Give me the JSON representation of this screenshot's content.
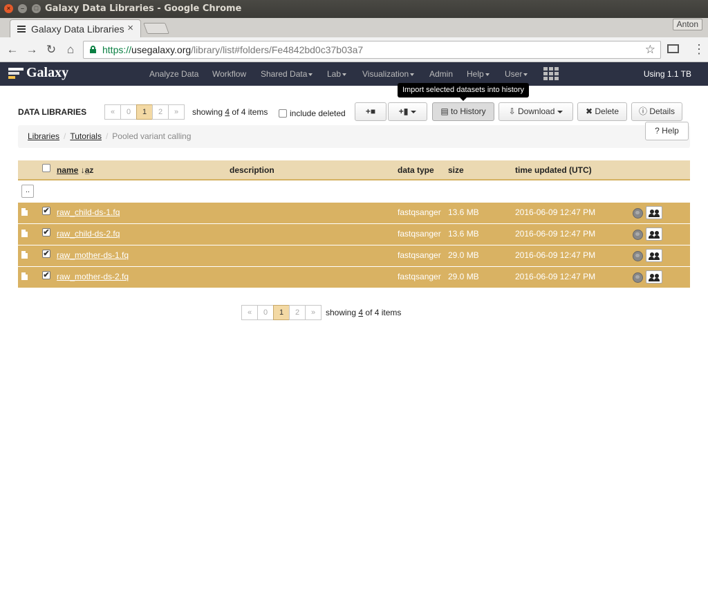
{
  "window": {
    "title": "Galaxy Data Libraries - Google Chrome"
  },
  "browser": {
    "tab_title": "Galaxy Data Libraries",
    "tab_close": "×",
    "profile_name": "Anton",
    "url_scheme": "https://",
    "url_host": "usegalaxy.org",
    "url_path": "/library/list#folders/Fe4842bd0c37b03a7",
    "back_glyph": "←",
    "forward_glyph": "→",
    "reload_glyph": "↻",
    "home_glyph": "⌂",
    "star_glyph": "☆",
    "menu_glyph": "⋮"
  },
  "masthead": {
    "brand": "Galaxy",
    "nav": [
      "Analyze Data",
      "Workflow",
      "Shared Data",
      "Lab",
      "Visualization",
      "Admin",
      "Help",
      "User"
    ],
    "usage": "Using 1.1 TB"
  },
  "tooltip": "Import selected datasets into history",
  "toolbar": {
    "title": "DATA LIBRARIES",
    "pager": {
      "prev": "«",
      "pages": [
        "0",
        "1",
        "2"
      ],
      "active_page": "1",
      "next": "»"
    },
    "showing_prefix": "showing",
    "showing_count": "4",
    "showing_suffix": "of 4 items",
    "include_deleted_label": "include deleted",
    "add_folder_icon": "+■",
    "add_dataset_icon": "+▮",
    "to_history_label": "to History",
    "download_label": "Download",
    "delete_label": "Delete",
    "details_label": "Details",
    "help_label": "Help",
    "book_icon": "▤",
    "download_icon": "⇩",
    "delete_icon": "✖",
    "info_icon": "ⓘ",
    "help_icon": "?"
  },
  "breadcrumb": {
    "items": [
      "Libraries",
      "Tutorials"
    ],
    "current": "Pooled variant calling",
    "separator": "/"
  },
  "table": {
    "columns": {
      "name": "name",
      "sort_icon": "↓a̲z",
      "description": "description",
      "data_type": "data type",
      "size": "size",
      "time_updated": "time updated (UTC)"
    },
    "up_label": "..",
    "rows": [
      {
        "name": "raw_child-ds-1.fq",
        "data_type": "fastqsanger",
        "size": "13.6 MB",
        "time_updated": "2016-06-09 12:47 PM",
        "checked": true
      },
      {
        "name": "raw_child-ds-2.fq",
        "data_type": "fastqsanger",
        "size": "13.6 MB",
        "time_updated": "2016-06-09 12:47 PM",
        "checked": true
      },
      {
        "name": "raw_mother-ds-1.fq",
        "data_type": "fastqsanger",
        "size": "29.0 MB",
        "time_updated": "2016-06-09 12:47 PM",
        "checked": true
      },
      {
        "name": "raw_mother-ds-2.fq",
        "data_type": "fastqsanger",
        "size": "29.0 MB",
        "time_updated": "2016-06-09 12:47 PM",
        "checked": true
      }
    ],
    "check_glyph": "✔"
  },
  "colors": {
    "masthead": "#2c3143",
    "row_bg": "#d9b263",
    "header_bg": "#ebd9b2",
    "active_page": "#f3d9a4"
  }
}
